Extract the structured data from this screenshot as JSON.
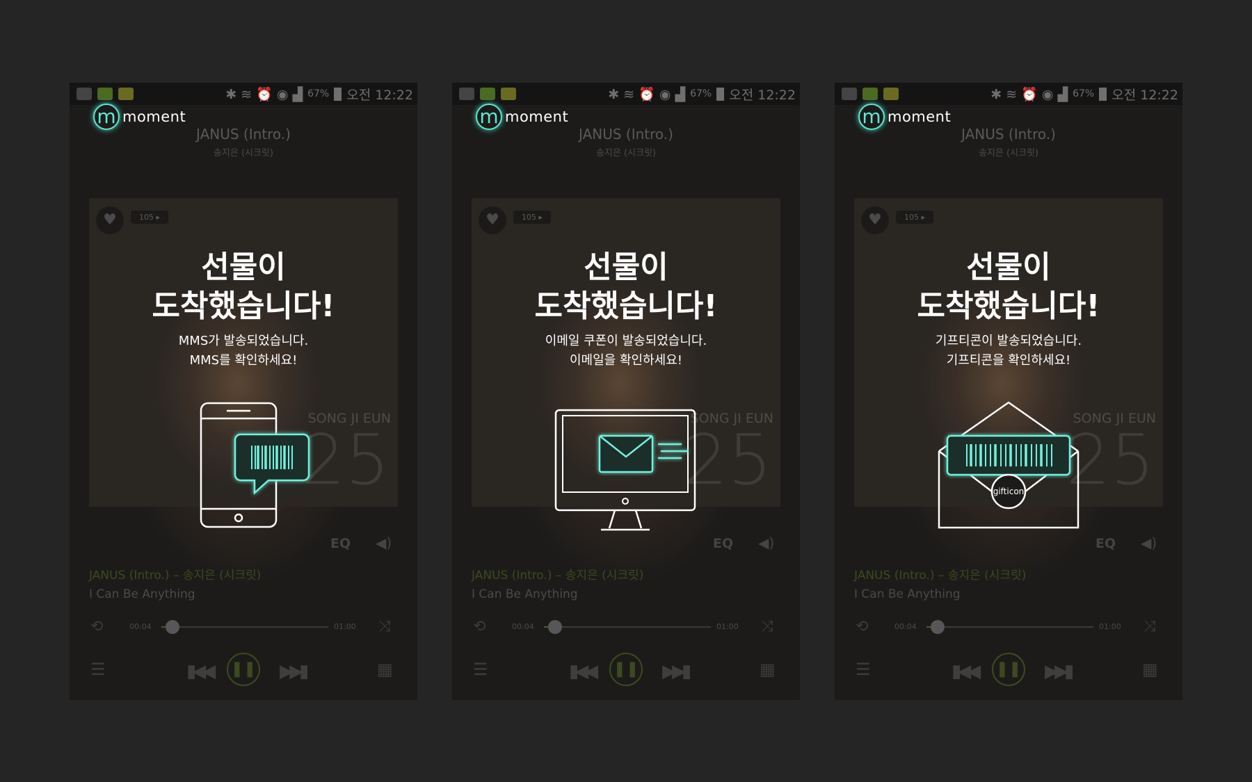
{
  "statusbar": {
    "battery": "67%",
    "time": "오전 12:22"
  },
  "brand": {
    "logo_mark": "m",
    "logo_text": "moment"
  },
  "player": {
    "track_title": "JANUS (Intro.)",
    "artist": "송지은 (시크릿)",
    "like_count": "105 ▸",
    "album_artist": "SONG JI EUN",
    "album_number": "25",
    "eq_label": "EQ",
    "now_playing": "JANUS (Intro.) – 송지은 (시크릿)",
    "next_track": "I Can Be Anything",
    "time_current": "00:04",
    "time_total": "01:00",
    "progress": 0.067
  },
  "screens": [
    {
      "title_line1": "선물이",
      "title_line2": "도착했습니다!",
      "msg_line1": "MMS가 발송되었습니다.",
      "msg_line2": "MMS를 확인하세요!",
      "illustration": "phone-barcode-icon"
    },
    {
      "title_line1": "선물이",
      "title_line2": "도착했습니다!",
      "msg_line1": "이메일 쿠폰이 발송되었습니다.",
      "msg_line2": "이메일을 확인하세요!",
      "illustration": "monitor-mail-icon"
    },
    {
      "title_line1": "선물이",
      "title_line2": "도착했습니다!",
      "msg_line1": "기프티콘이 발송되었습니다.",
      "msg_line2": "기프티콘을 확인하세요!",
      "illustration": "envelope-gifticon-icon",
      "badge": "gifticon"
    }
  ],
  "colors": {
    "accent": "#5fe8d2",
    "background": "#252525",
    "screen": "#1c1b1a"
  }
}
